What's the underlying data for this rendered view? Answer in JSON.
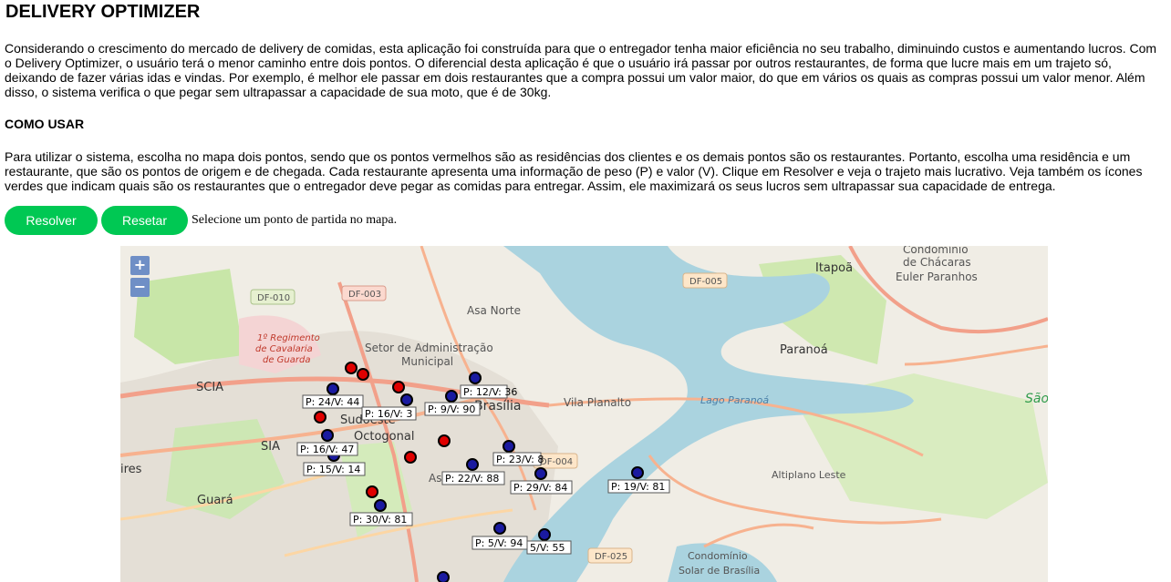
{
  "header": {
    "title": "DELIVERY OPTIMIZER"
  },
  "intro": {
    "text": "Considerando o crescimento do mercado de delivery de comidas, esta aplicação foi construída para que o entregador tenha maior eficiência no seu trabalho, diminuindo custos e aumentando lucros. Com o Delivery Optimizer, o usuário terá o menor caminho entre dois pontos. O diferencial desta aplicação é que o usuário irá passar por outros restaurantes, de forma que lucre mais em um trajeto só, deixando de fazer várias idas e vindas. Por exemplo, é melhor ele passar em dois restaurantes que a compra possui um valor maior, do que em vários os quais as compras possui um valor menor. Além disso, o sistema verifica o que pegar sem ultrapassar a capacidade de sua moto, que é de 30kg."
  },
  "how_to": {
    "heading": "COMO USAR",
    "text": "Para utilizar o sistema, escolha no mapa dois pontos, sendo que os pontos vermelhos são as residências dos clientes e os demais pontos são os restaurantes. Portanto, escolha uma residência e um restaurante, que são os pontos de origem e de chegada. Cada restaurante apresenta uma informação de peso (P) e valor (V). Clique em Resolver e veja o trajeto mais lucrativo. Veja também os ícones verdes que indicam quais são os restaurantes que o entregador deve pegar as comidas para entregar. Assim, ele maximizará os seus lucros sem ultrapassar sua capacidade de entrega."
  },
  "controls": {
    "resolver_label": "Resolver",
    "resetar_label": "Resetar",
    "status": "Selecione um ponto de partida no mapa."
  },
  "map": {
    "zoom_in": "+",
    "zoom_out": "−",
    "place_labels": {
      "condominio_top": "Condomínio",
      "chacaras": "de Chácaras",
      "euler": "Euler Paranhos",
      "itapoa": "Itapoã",
      "df005": "DF-005",
      "df010": "DF-010",
      "df003": "DF-003",
      "asa_norte": "Asa Norte",
      "regimento1": "1º Regimento",
      "regimento2": "de Cavalaria",
      "regimento3": "de Guarda",
      "setor1": "Setor de Administração",
      "setor2": "Municipal",
      "paranoa": "Paranoá",
      "scia": "SCIA",
      "brasilia": "Brasília",
      "vila_planalto": "Vila Planalto",
      "lago_paranoa": "Lago Paranoá",
      "sao": "São",
      "sudoeste": "Sudoeste",
      "octogonal": "Octogonal",
      "sia": "SIA",
      "df004": "DF-004",
      "ires": "ires",
      "altiplano": "Altiplano Leste",
      "guara": "Guará",
      "asa_sul": "As",
      "df025": "DF-025",
      "condominio_bottom": "Condomínio",
      "solar": "Solar de Brasília"
    },
    "restaurant_labels": [
      "P: 12/V: 36",
      "P: 24/V: 44",
      "P: 16/V: 3",
      "P: 9/V: 90",
      "P: 16/V: 47",
      "P: 23/V: 8",
      "P: 15/V: 14",
      "P: 22/V: 88",
      "P: 29/V: 84",
      "P: 19/V: 81",
      "P: 30/V: 81",
      "P: 5/V: 94",
      "5/V: 55"
    ],
    "colors": {
      "residence_marker": "#e00000",
      "restaurant_marker": "#1a1aa0",
      "water": "#aad3df",
      "park": "#c8e6a8",
      "button": "#00c853"
    }
  }
}
